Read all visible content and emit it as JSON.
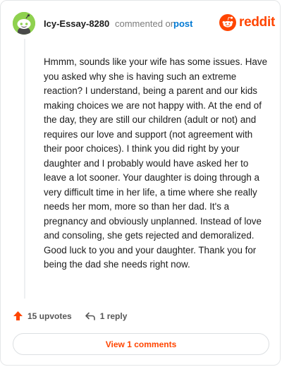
{
  "header": {
    "username": "Icy-Essay-8280",
    "action_text": "commented on",
    "post_link": "post",
    "brand_wordmark": "reddit"
  },
  "avatar": {
    "icon": "snoo-avatar-icon",
    "background": "#8fd14f"
  },
  "comment": {
    "body": "Hmmm, sounds like your wife has some issues. Have you asked why she is having such an extreme reaction? I understand, being a parent and our kids making choices we are not happy with. At the end of the day, they are still our children (adult or not) and requires our love and support (not agreement with their poor choices). I think you did right by your daughter and I probably would have asked her to leave a lot sooner. Your daughter is doing through a very difficult time in her life, a time where she really needs her mom, more so than her dad. It's a pregnancy and obviously unplanned. Instead of love and consoling, she gets rejected and demoralized. Good luck to you and your daughter. Thank you for being the dad she needs right now."
  },
  "actions": {
    "upvotes": "15 upvotes",
    "replies": "1 reply",
    "view_comments": "View 1 comments"
  },
  "colors": {
    "brand": "#ff4500",
    "link": "#0079d3",
    "text": "#1c1c1c",
    "muted": "#7c7c7c"
  }
}
